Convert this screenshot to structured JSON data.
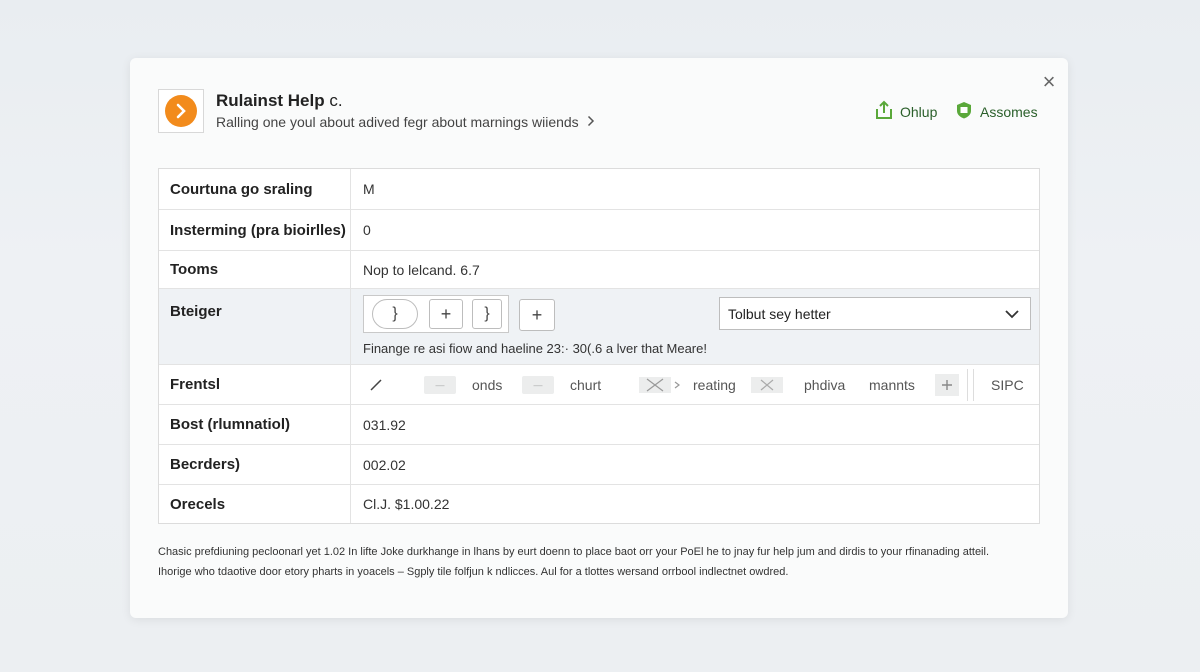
{
  "header": {
    "title": "Rulainst Help",
    "title_suffix": "c.",
    "subtitle": "Ralling one youl about adived fegr about marnings wiiends",
    "actions": [
      {
        "label": "Ohlup",
        "icon": "upload-icon"
      },
      {
        "label": "Assomes",
        "icon": "shield-icon"
      }
    ],
    "close_glyph": "×"
  },
  "rows": {
    "r1": {
      "label": "Courtuna go sraling",
      "value": "M"
    },
    "r2": {
      "label": "Insterming (pra bioirlles)",
      "value": "0"
    },
    "r3": {
      "label": "Tooms",
      "value": "Nop to lelcand. 6.7"
    },
    "r4": {
      "label": "Bteiger",
      "stepper_a": "}",
      "stepper_b": "}",
      "plus": "+",
      "select_value": "Tolbut sey hetter",
      "note": "Finange re asi fiow and haeline 23:· 30(.6 a lver that Meare!"
    },
    "r5": {
      "label": "Frentsl",
      "tool_labels": [
        "onds",
        "churt",
        "reating",
        "phdiva",
        "mannts"
      ],
      "sipc": "SIPC"
    },
    "r6": {
      "label": "Bost (rlumnatiol)",
      "value": "031.92"
    },
    "r7": {
      "label": "Becrders)",
      "value": "002.02"
    },
    "r8": {
      "label": "Orecels",
      "value": "Cl.J. $1.00.22"
    }
  },
  "footer": {
    "line1": "Chasic prefdiuning pecloonarl yet 1.02   In lifte Joke durkhange in lhans by eurt doenn to place baot orr your PoEl he to jnay fur help jum and dirdis to your rfinanading atteil.",
    "line2": "Ihorige who tdaotive door etory pharts in yoacels – Sgply tile folfjun k ndlicces. Aul for a tlottes wersand orrbool indlectnet owdred."
  },
  "colors": {
    "accent_orange": "#f28b1c",
    "accent_green": "#5aa83a"
  }
}
